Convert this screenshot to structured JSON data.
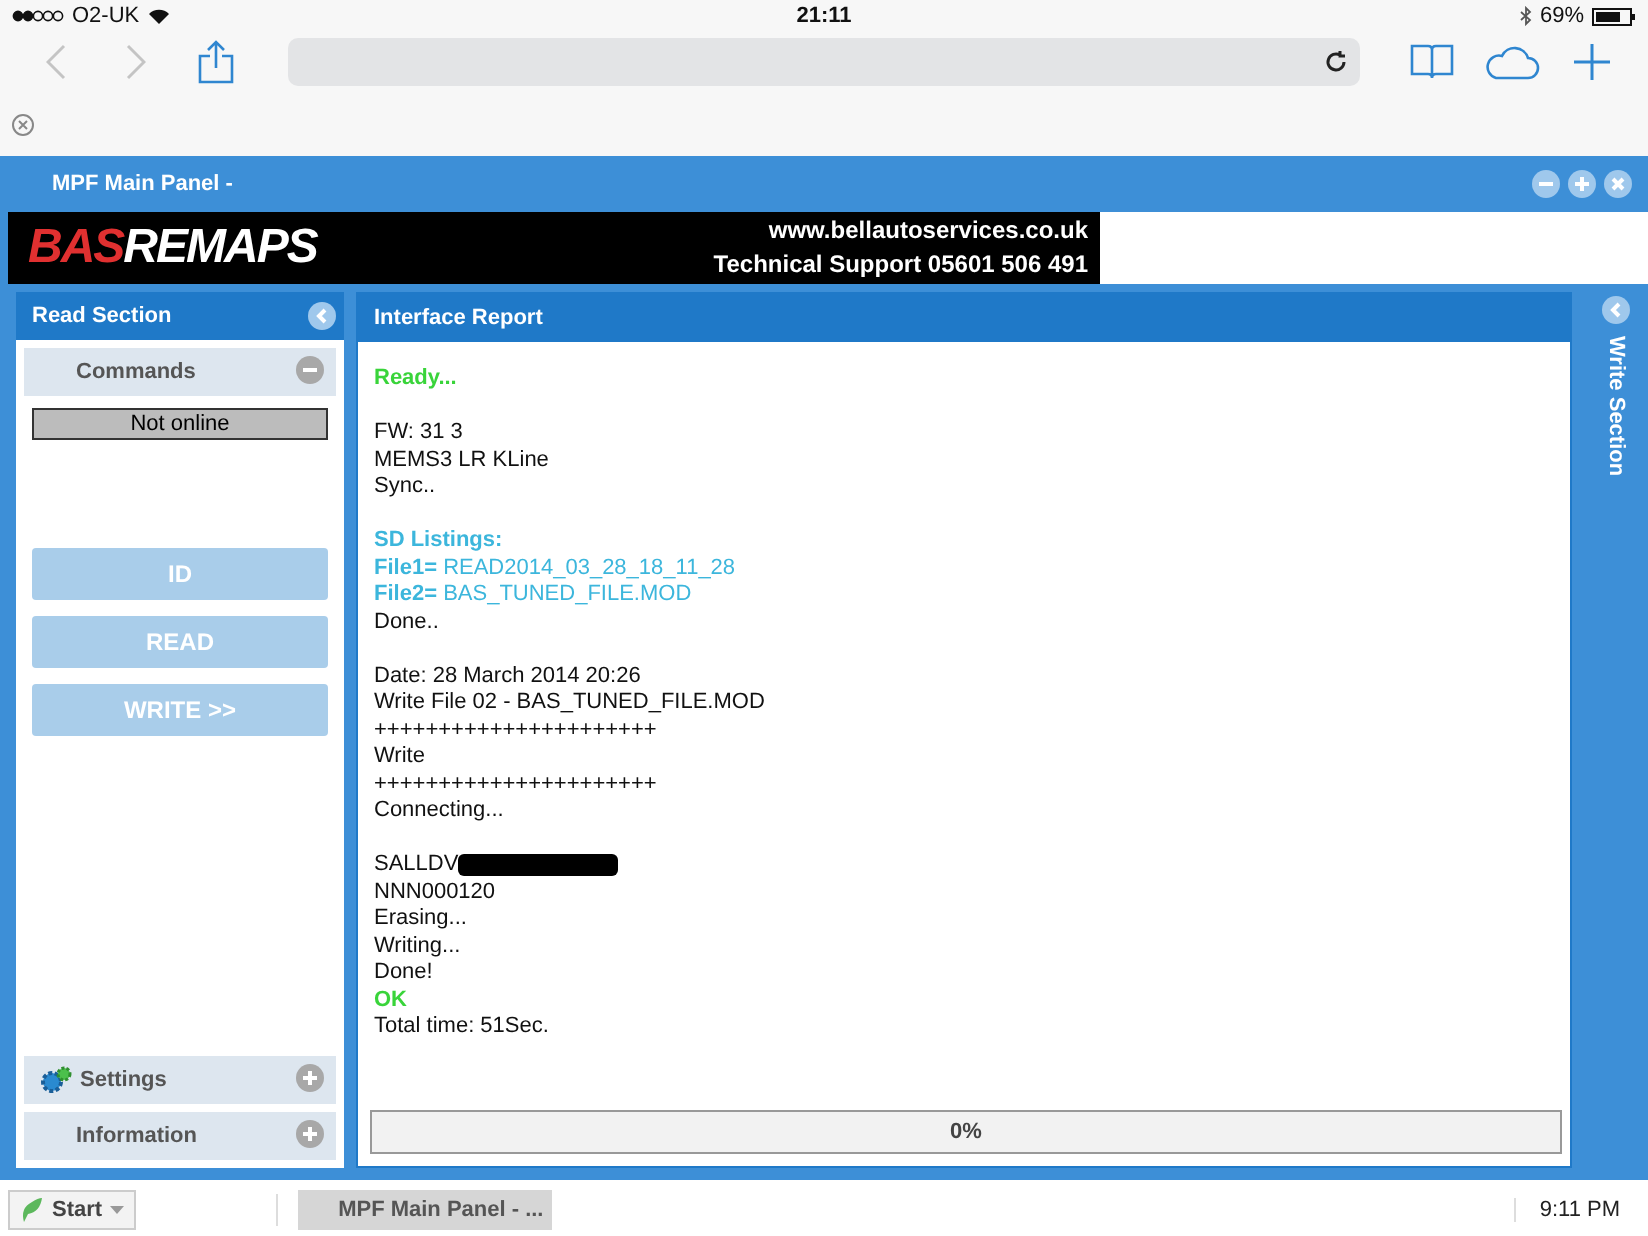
{
  "status_bar": {
    "carrier": "O2-UK",
    "time": "21:11",
    "battery": "69%"
  },
  "window": {
    "title": "MPF Main Panel -"
  },
  "banner": {
    "logo": "BASREMAPS",
    "url": "www.bellautoservices.co.uk",
    "support": "Technical Support 05601 506 491"
  },
  "read_section": {
    "title": "Read Section",
    "commands": {
      "label": "Commands",
      "expanded": true,
      "status": "Not online"
    },
    "buttons": [
      {
        "label": "ID",
        "disabled": true
      },
      {
        "label": "READ",
        "disabled": true
      },
      {
        "label": "WRITE >>",
        "disabled": true
      }
    ],
    "panels": [
      {
        "label": "Settings",
        "expanded": false
      },
      {
        "label": "Information",
        "expanded": false
      }
    ]
  },
  "interface_report": {
    "title": "Interface Report",
    "blocks": [
      {
        "lines": [
          {
            "kind": "success",
            "text": "Ready..."
          }
        ]
      },
      {
        "lines": [
          {
            "kind": "plain",
            "text": "FW: 31 3"
          },
          {
            "kind": "plain",
            "text": "MEMS3 LR KLine"
          },
          {
            "kind": "plain",
            "text": "Sync.."
          }
        ]
      },
      {
        "lines": [
          {
            "kind": "heading",
            "text": "SD Listings:"
          },
          {
            "kind": "file",
            "label": "File1=",
            "text": "READ2014_03_28_18_11_28"
          },
          {
            "kind": "file",
            "label": "File2=",
            "text": "BAS_TUNED_FILE.MOD"
          },
          {
            "kind": "plain",
            "text": "Done.."
          }
        ]
      },
      {
        "lines": [
          {
            "kind": "plain",
            "text": "Date: 28 March 2014 20:26"
          },
          {
            "kind": "plain",
            "text": "Write File 02 - BAS_TUNED_FILE.MOD"
          },
          {
            "kind": "plain",
            "text": "++++++++++++++++++++++"
          },
          {
            "kind": "plain",
            "text": "Write"
          },
          {
            "kind": "plain",
            "text": "++++++++++++++++++++++"
          },
          {
            "kind": "plain",
            "text": "Connecting..."
          }
        ]
      },
      {
        "lines": [
          {
            "kind": "redacted",
            "text": "SALLDV"
          },
          {
            "kind": "plain",
            "text": "NNN000120"
          },
          {
            "kind": "plain",
            "text": "Erasing..."
          },
          {
            "kind": "plain",
            "text": "Writing..."
          },
          {
            "kind": "plain",
            "text": "Done!"
          },
          {
            "kind": "success",
            "text": "OK"
          },
          {
            "kind": "plain",
            "text": "Total time: 51Sec."
          }
        ]
      }
    ],
    "progress": {
      "level": 0,
      "reading": "0%"
    }
  },
  "write_section": {
    "title": "Write Section"
  },
  "taskbar": {
    "start": "Start",
    "tasks": [
      {
        "label": "MPF Main Panel - ...",
        "selected": true
      }
    ],
    "clock": "9:11 PM"
  }
}
